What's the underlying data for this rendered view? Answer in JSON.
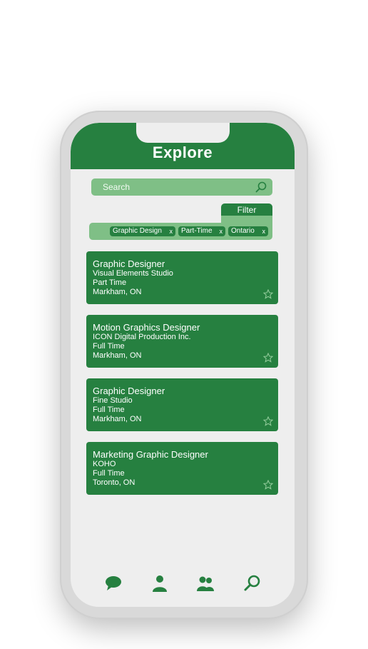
{
  "header": {
    "title": "Explore"
  },
  "search": {
    "placeholder": "Search"
  },
  "filter": {
    "label": "Filter",
    "chips": [
      {
        "label": "Graphic Design",
        "remove": "x"
      },
      {
        "label": "Part-Time",
        "remove": "x"
      },
      {
        "label": "Ontario",
        "remove": "x"
      }
    ]
  },
  "jobs": [
    {
      "title": "Graphic Designer",
      "company": "Visual Elements Studio",
      "type": "Part Time",
      "location": "Markham, ON"
    },
    {
      "title": "Motion Graphics Designer",
      "company": "ICON Digital Production Inc.",
      "type": "Full Time",
      "location": "Markham, ON"
    },
    {
      "title": "Graphic Designer",
      "company": "Fine Studio",
      "type": "Full Time",
      "location": "Markham, ON"
    },
    {
      "title": "Marketing Graphic Designer",
      "company": "KOHO",
      "type": "Full Time",
      "location": "Toronto, ON"
    }
  ],
  "nav": {
    "icons": [
      "chat-icon",
      "profile-icon",
      "people-icon",
      "search-icon"
    ]
  },
  "colors": {
    "primary": "#268040",
    "light": "#7fbf86",
    "background": "#eeeeee"
  }
}
